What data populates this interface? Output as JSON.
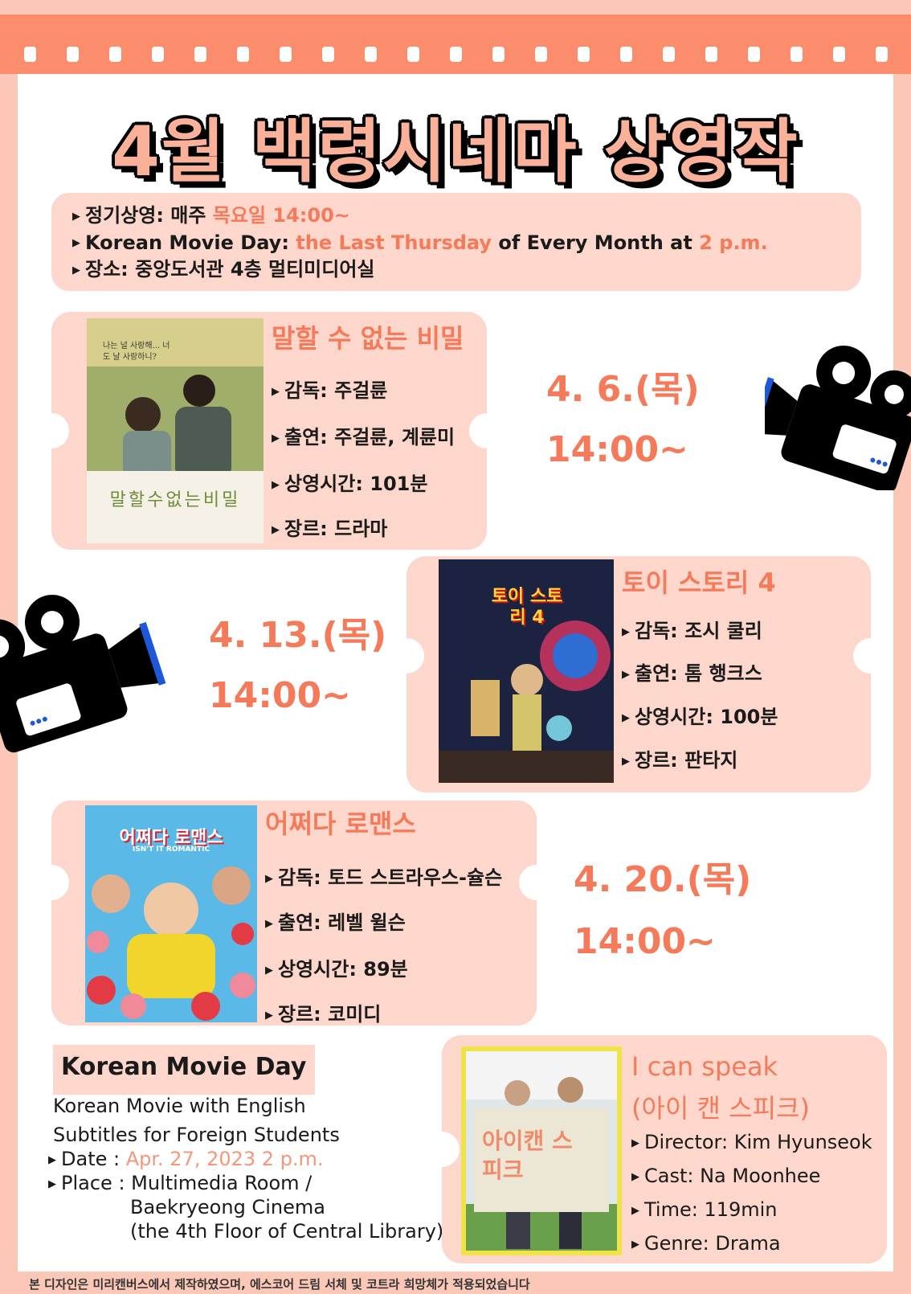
{
  "header": {
    "title": "4월 백령시네마 상영작"
  },
  "info": {
    "line1_label": "정기상영: 매주 ",
    "line1_accent": "목요일 14:00~",
    "line2_label": "Korean Movie Day: ",
    "line2_accent1": "the Last Thursday",
    "line2_mid": " of Every Month at ",
    "line2_accent2": "2 p.m.",
    "line3": "장소: 중앙도서관 4층 멀티미디어실"
  },
  "movies": [
    {
      "title": "말할 수 없는 비밀",
      "director": "감독: 주걸륜",
      "cast": "출연: 주걸륜, 계륜미",
      "runtime": "상영시간: 101분",
      "genre": "장르: 드라마",
      "date": "4. 6.(목)",
      "time": "14:00~"
    },
    {
      "title": "토이 스토리 4",
      "director": "감독: 조시 쿨리",
      "cast": "출연:  톰 행크스",
      "runtime": "상영시간: 100분",
      "genre": "장르: 판타지",
      "date": "4. 13.(목)",
      "time": "14:00~"
    },
    {
      "title": "어쩌다 로맨스",
      "director": "감독: 토드 스트라우스-슐슨",
      "cast": "출연: 레벨 윌슨",
      "runtime": "상영시간: 89분",
      "genre": "장르: 코미디",
      "date": "4. 20.(목)",
      "time": "14:00~"
    }
  ],
  "posters": {
    "p1_title": "말할수없는비밀",
    "p1_sub": "나는 널 사랑해... 너도 날 사랑하니?",
    "p2_title": "토이 스토리 4",
    "p3_title": "어쩌다 로맨스",
    "p3_sub": "ISN'T IT ROMANTIC",
    "p4_title": "아이캔 스피크"
  },
  "kmd": {
    "heading": "Korean Movie Day",
    "desc1": "Korean Movie with English",
    "desc2": "Subtitles for Foreign Students",
    "date_label": "Date : ",
    "date_value": "Apr. 27, 2023 2 p.m.",
    "place_label": "Place : ",
    "place1": "Multimedia Room /",
    "place2": "Baekryeong Cinema",
    "place3": "(the 4th Floor of Central Library)",
    "movie_title1": "I can speak",
    "movie_title2": "(아이 캔 스피크)",
    "director": "Director: Kim Hyunseok",
    "cast": "Cast:  Na Moonhee",
    "time": "Time: 119min",
    "genre": "Genre: Drama"
  },
  "footer": "본 디자인은 미리캔버스에서 제작하였으며, 에스코어 드림 서체 및 코트라 희망체가 적용되었습니다",
  "colors": {
    "accent": "#f57a5a",
    "ticket": "#fdd7cb",
    "border": "#fbc8b8",
    "film": "#fb8c6c"
  }
}
